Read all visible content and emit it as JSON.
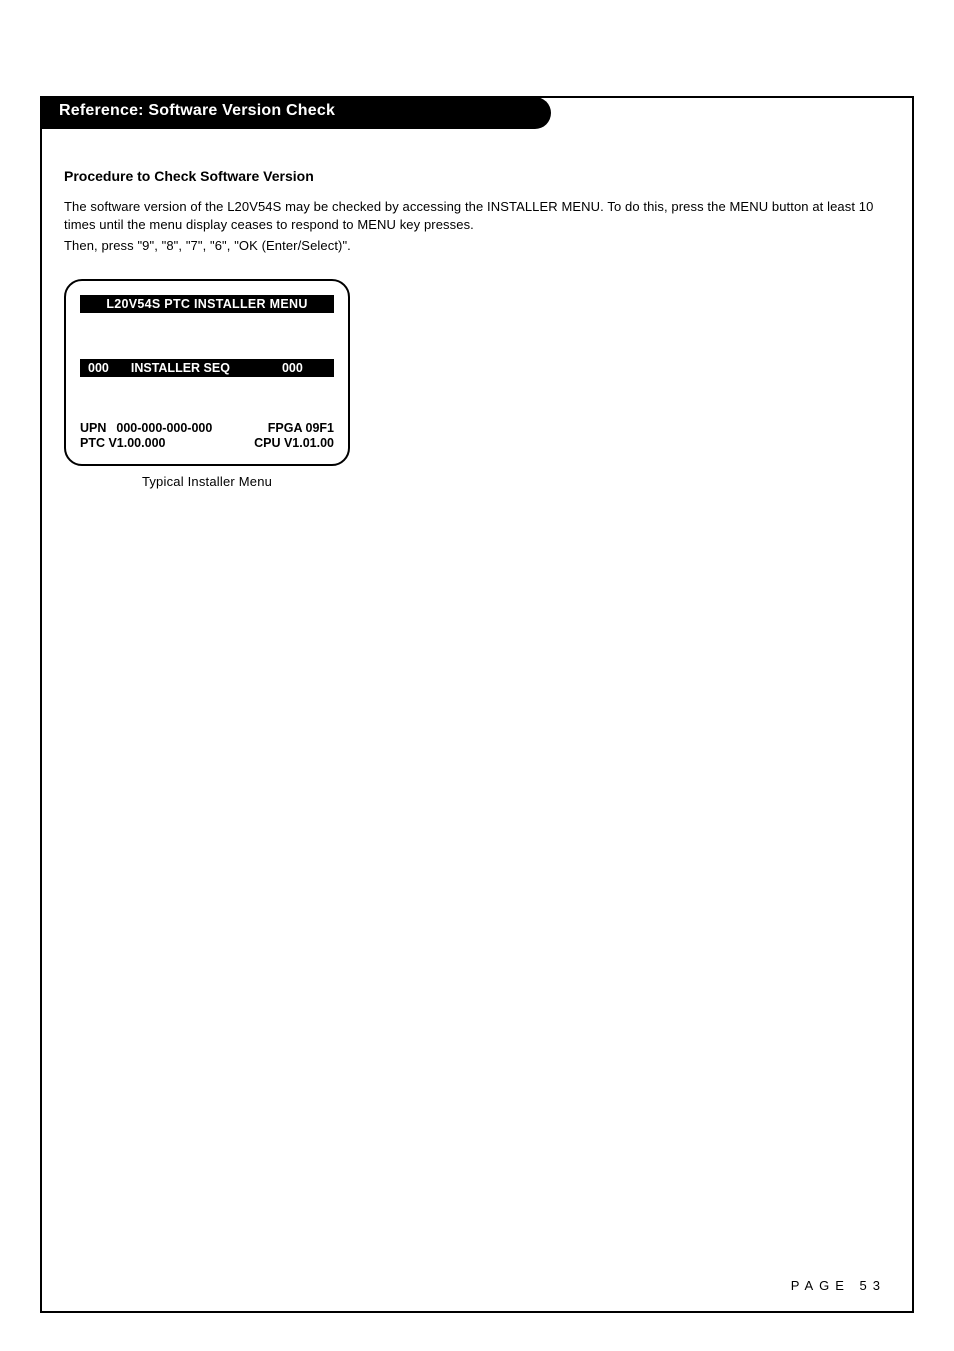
{
  "header": {
    "title": "Reference: Software Version Check"
  },
  "section": {
    "heading": "Procedure to Check Software Version",
    "p1": "The software version of the L20V54S may be checked by accessing the INSTALLER MENU. To do this, press the MENU button at least 10 times until the menu display ceases to respond to MENU key presses.",
    "p2": "Then, press \"9\", \"8\", \"7\", \"6\", \"OK (Enter/Select)\"."
  },
  "menu": {
    "title": "L20V54S PTC INSTALLER MENU",
    "seq_left": "000",
    "seq_label": "INSTALLER SEQ",
    "seq_right": "000",
    "upn_label": "UPN",
    "upn_value": "000-000-000-000",
    "fpga": "FPGA 09F1",
    "ptc": "PTC V1.00.000",
    "cpu": "CPU V1.01.00"
  },
  "caption": "Typical Installer Menu",
  "page_label": "PAGE 53"
}
